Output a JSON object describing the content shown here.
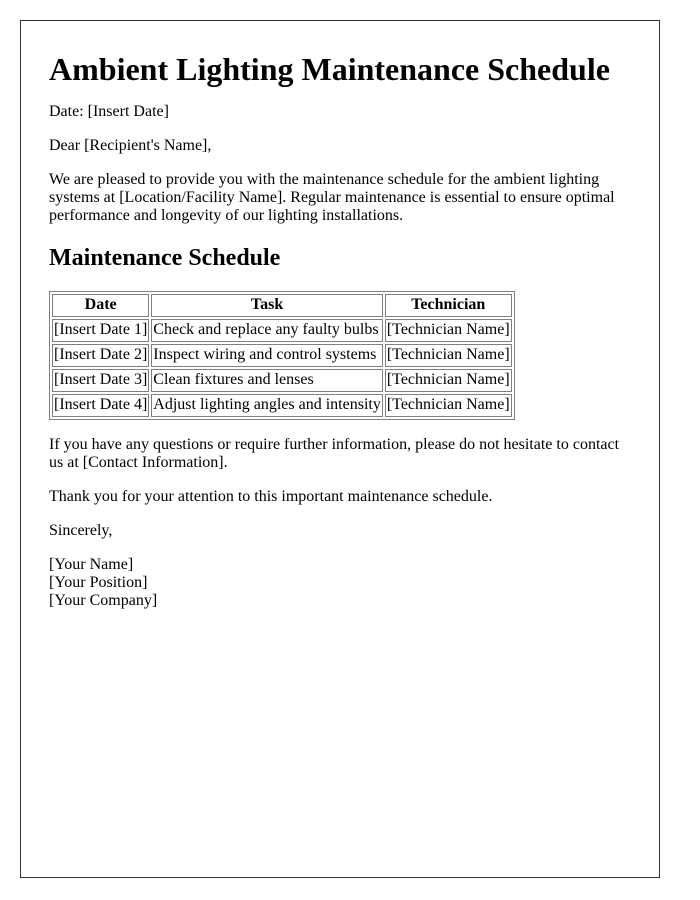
{
  "letter": {
    "title": "Ambient Lighting Maintenance Schedule",
    "date_line": "Date: [Insert Date]",
    "salutation": "Dear [Recipient's Name],",
    "intro": "We are pleased to provide you with the maintenance schedule for the ambient lighting systems at [Location/Facility Name]. Regular maintenance is essential to ensure optimal performance and longevity of our lighting installations.",
    "section_heading": "Maintenance Schedule",
    "table": {
      "headers": [
        "Date",
        "Task",
        "Technician"
      ],
      "rows": [
        [
          "[Insert Date 1]",
          "Check and replace any faulty bulbs",
          "[Technician Name]"
        ],
        [
          "[Insert Date 2]",
          "Inspect wiring and control systems",
          "[Technician Name]"
        ],
        [
          "[Insert Date 3]",
          "Clean fixtures and lenses",
          "[Technician Name]"
        ],
        [
          "[Insert Date 4]",
          "Adjust lighting angles and intensity",
          "[Technician Name]"
        ]
      ]
    },
    "contact_paragraph": "If you have any questions or require further information, please do not hesitate to contact us at [Contact Information].",
    "thanks": "Thank you for your attention to this important maintenance schedule.",
    "closing": "Sincerely,",
    "signature": {
      "name": "[Your Name]",
      "position": "[Your Position]",
      "company": "[Your Company]"
    }
  }
}
